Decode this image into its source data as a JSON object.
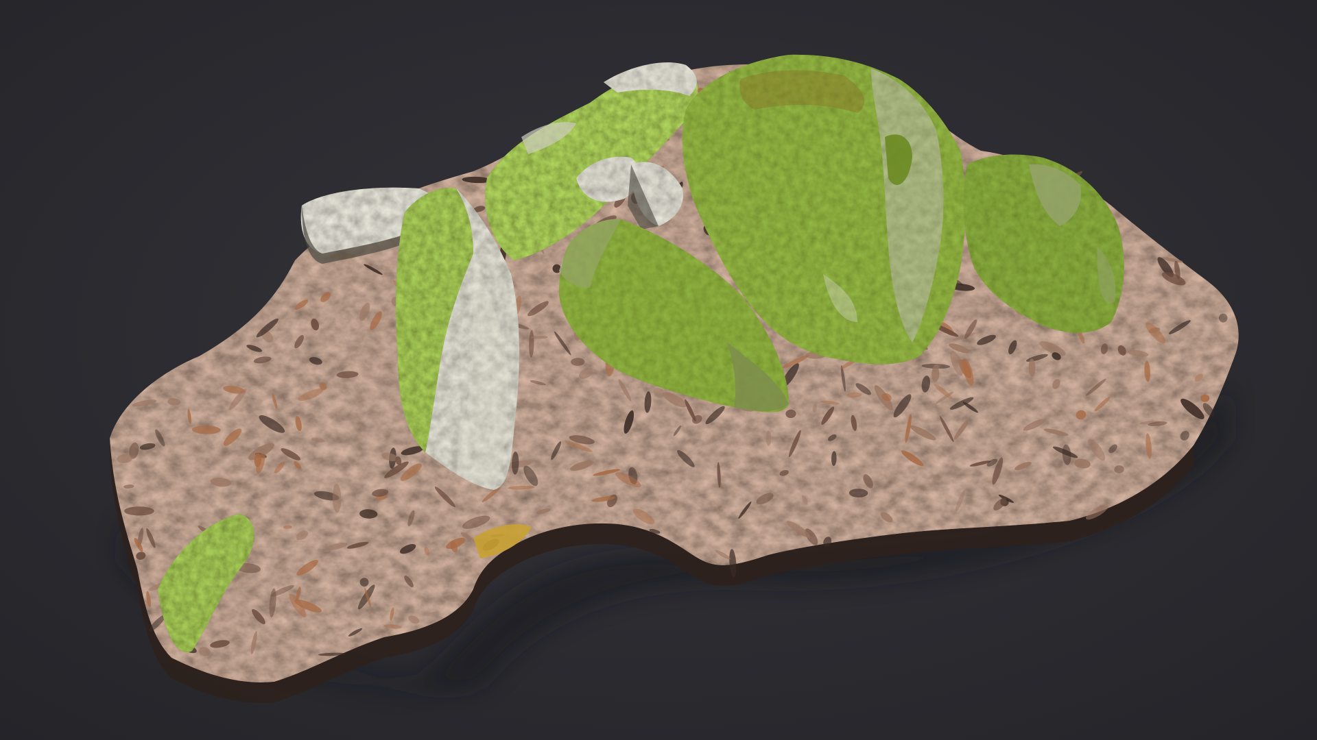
{
  "scene": {
    "subject": "moss-covered-rocks-on-leaf-litter",
    "colors": {
      "background_center": "#34343a",
      "background_edge": "#242429",
      "leaf_litter_dark": "#3b2b25",
      "leaf_litter_mid": "#6b4c3e",
      "leaf_litter_light": "#9a7662",
      "leaf_orange": "#a86a44",
      "leaf_yellow": "#c8a132",
      "moss_dark": "#3c5a1a",
      "moss_mid": "#6b8a24",
      "moss_light": "#9cb03a",
      "moss_orange": "#a0622a",
      "rock_dark": "#6f6d62",
      "rock_mid": "#a3a190",
      "rock_light": "#d4d2c4",
      "shadow": "#15151a"
    }
  }
}
